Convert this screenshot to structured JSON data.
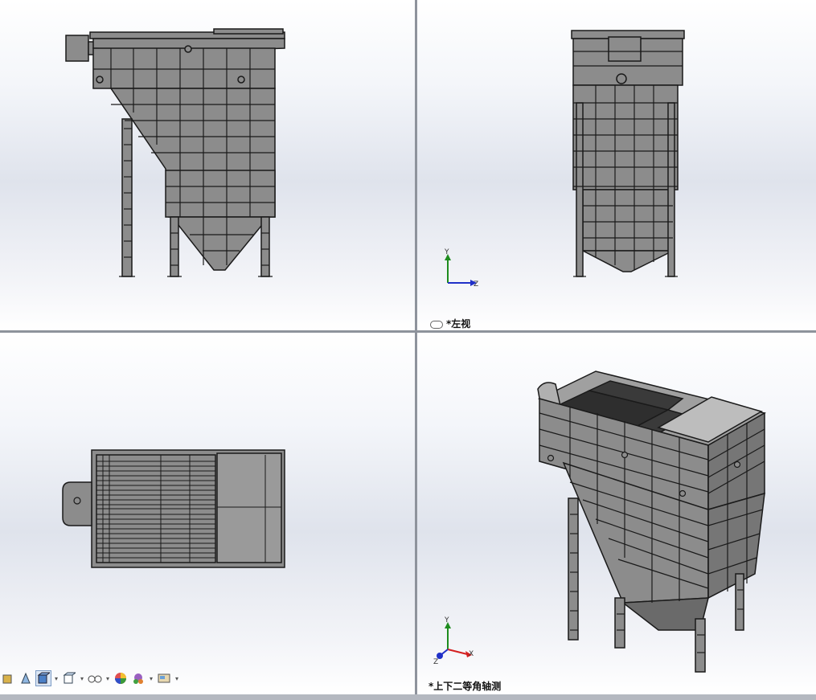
{
  "viewports": {
    "top_left": {
      "label": ""
    },
    "top_right": {
      "label": "*左视"
    },
    "bottom_left": {
      "label": ""
    },
    "bottom_right": {
      "label": "*上下二等角轴测"
    }
  },
  "triad": {
    "x": "X",
    "y": "Y",
    "z": "Z"
  },
  "toolbar": {
    "items": [
      "view-orientation-icon",
      "section-view-icon",
      "display-style-icon",
      "hide-show-items-icon",
      "scene-icon",
      "appearance-icon",
      "realview-icon",
      "view-settings-icon"
    ]
  },
  "colors": {
    "model_fill": "#8c8c8c",
    "model_line": "#1a1a1a",
    "triad_x": "#d42020",
    "triad_y": "#1e8c1e",
    "triad_z": "#2030c8"
  }
}
